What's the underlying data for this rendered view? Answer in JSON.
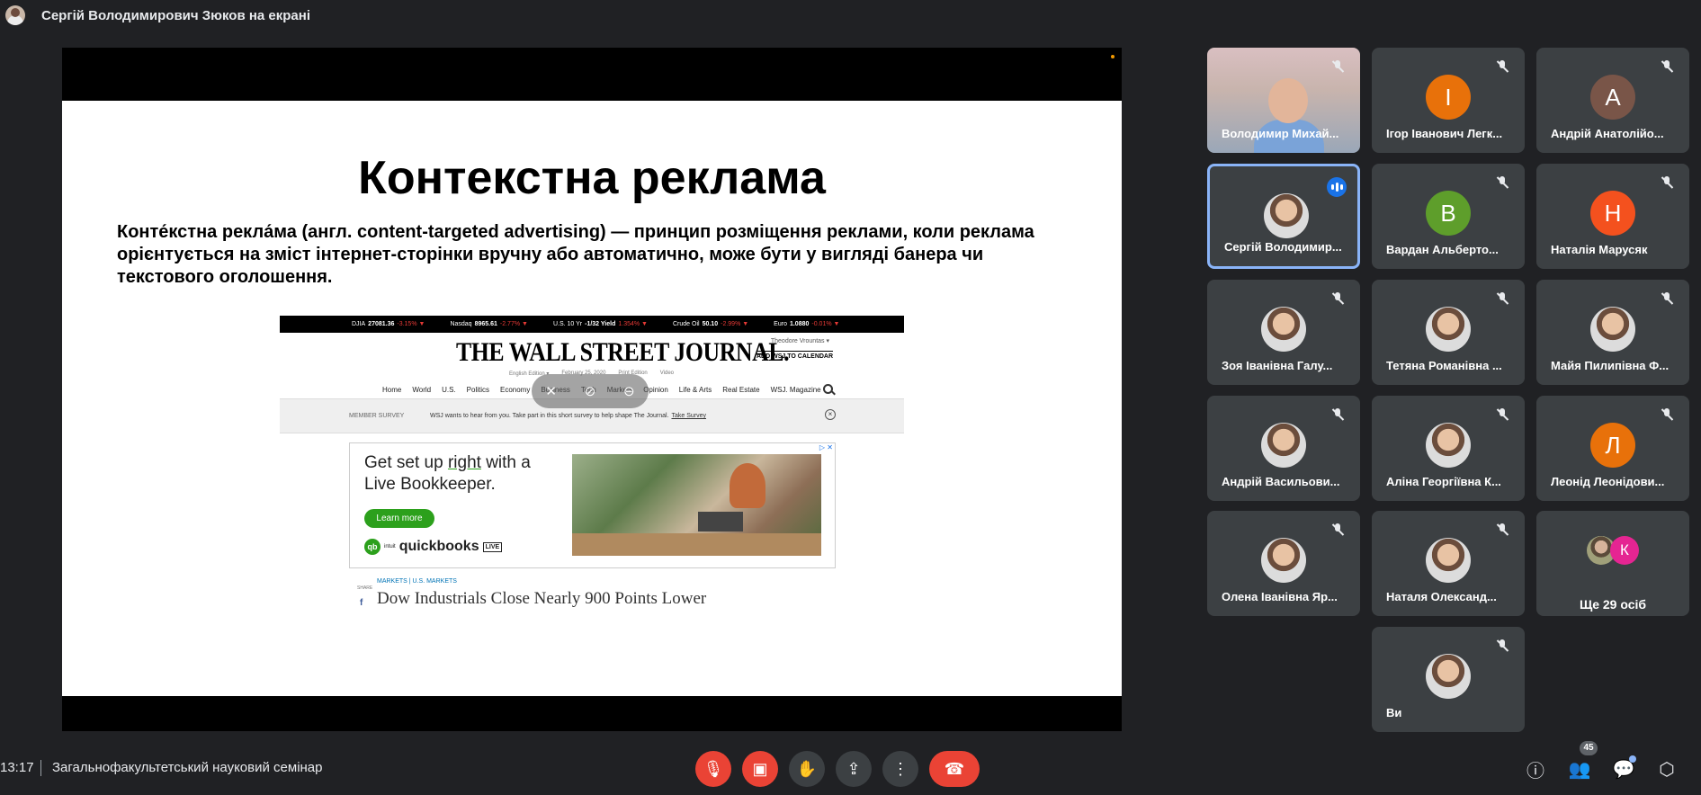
{
  "topbar": {
    "presenter_text": "Сергій Володимирович Зюков на екрані"
  },
  "slide": {
    "title": "Контекстна реклама",
    "body": "Конте́кстна рекла́ма (англ. content-targeted advertising) — принцип розміщення реклами, коли реклама орієнтується на зміст інтернет-сторінки вручну або автоматично, може бути у вигляді банера чи текстового оголошення."
  },
  "wsj": {
    "ticker": [
      {
        "label": "DJIA",
        "value": "27081.36",
        "change": "-3.15% ▼"
      },
      {
        "label": "Nasdaq",
        "value": "8965.61",
        "change": "-2.77% ▼"
      },
      {
        "label": "U.S. 10 Yr",
        "value": "-1/32 Yield",
        "change": "1.354% ▼"
      },
      {
        "label": "Crude Oil",
        "value": "50.10",
        "change": "-2.99% ▼"
      },
      {
        "label": "Euro",
        "value": "1.0880",
        "change": "-0.01% ▼"
      }
    ],
    "masthead": "THE WALL STREET JOURNAL.",
    "user": "Theodore Vrountas ▾",
    "add_calendar": "ADD WSJ TO CALENDAR",
    "sub_nav": [
      "English Edition ▾",
      "February 25, 2020",
      "Print Edition",
      "Video"
    ],
    "nav": [
      "Home",
      "World",
      "U.S.",
      "Politics",
      "Economy",
      "Business",
      "Tech",
      "Markets",
      "Opinion",
      "Life & Arts",
      "Real Estate",
      "WSJ. Magazine"
    ],
    "survey_label": "MEMBER SURVEY",
    "survey_msg": "WSJ wants to hear from you. Take part in this short survey to help shape The Journal.",
    "survey_link": "Take Survey",
    "ad": {
      "head_1": "Get set up ",
      "head_underline": "right",
      "head_2": " with a Live Bookkeeper.",
      "button": "Learn more",
      "brand_small": "intuit",
      "brand": "quickbooks",
      "brand_badge": "LIVE",
      "choices": "▷ ✕"
    },
    "share": "SHARE",
    "kicker": "MARKETS  |  U.S. MARKETS",
    "headline": "Dow Industrials Close Nearly 900 Points Lower"
  },
  "participants": [
    {
      "name": "Володимир Михай...",
      "type": "camera"
    },
    {
      "name": "Ігор Іванович Легк...",
      "type": "letter",
      "letter": "І",
      "color": "#e8710a"
    },
    {
      "name": "Андрій Анатолійо...",
      "type": "letter",
      "letter": "А",
      "color": "#795548"
    },
    {
      "name": "Сергій Володимир...",
      "type": "photo",
      "speaking": true
    },
    {
      "name": "Вардан Альберто...",
      "type": "letter",
      "letter": "В",
      "color": "#5e9e2b"
    },
    {
      "name": "Наталія Марусяк",
      "type": "letter",
      "letter": "Н",
      "color": "#f4511e"
    },
    {
      "name": "Зоя Іванівна Галу...",
      "type": "photo"
    },
    {
      "name": "Тетяна Романівна ...",
      "type": "photo"
    },
    {
      "name": "Майя Пилипівна Ф...",
      "type": "photo"
    },
    {
      "name": "Андрій Васильови...",
      "type": "photo"
    },
    {
      "name": "Аліна Георгіївна К...",
      "type": "photo"
    },
    {
      "name": "Леонід Леонідови...",
      "type": "letter",
      "letter": "Л",
      "color": "#e8710a"
    },
    {
      "name": "Олена Іванівна Яр...",
      "type": "photo"
    },
    {
      "name": "Наталя Олександ...",
      "type": "photo"
    },
    {
      "name": "Ви",
      "type": "photo"
    }
  ],
  "more": {
    "label": "Ще 29 осіб",
    "letter": "К",
    "color": "#e52592"
  },
  "bottombar": {
    "time": "13:17",
    "meeting_title": "Загальнофакультетський науковий семінар",
    "people_count": "45"
  }
}
